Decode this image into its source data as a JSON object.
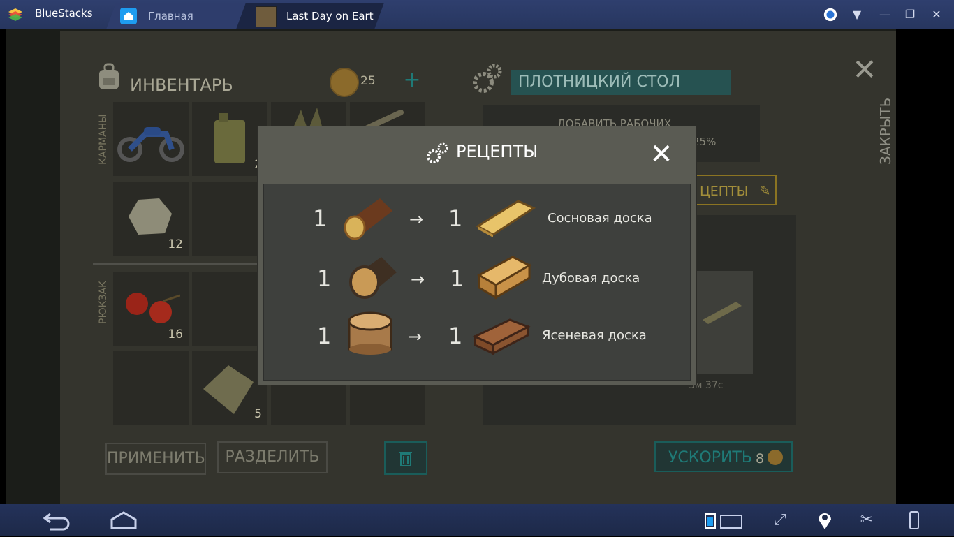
{
  "window": {
    "app_name": "BlueStacks",
    "tabs": [
      {
        "label": "Главная",
        "icon": "home-icon"
      },
      {
        "label": "Last Day on Eart",
        "icon": "game-icon"
      }
    ],
    "controls": [
      "account-icon",
      "menu-dropdown-icon",
      "minimize-icon",
      "restore-icon",
      "close-icon"
    ]
  },
  "inventory": {
    "title": "ИНВЕНТАРЬ",
    "coins": "25",
    "pockets_label": "КАРМАНЫ",
    "backpack_label": "РЮКЗАК",
    "slots": [
      {
        "item": "motorcycle",
        "count": ""
      },
      {
        "item": "jerrycan",
        "count": "2"
      },
      {
        "item": "plant",
        "count": ""
      },
      {
        "item": "branch",
        "count": ""
      },
      {
        "item": "stone",
        "count": "12"
      },
      {
        "item": "berries",
        "count": "16"
      },
      {
        "item": "cloth",
        "count": "5"
      }
    ],
    "apply_button": "ПРИМЕНИТЬ",
    "split_button": "РАЗДЕЛИТЬ"
  },
  "workbench": {
    "title": "ПЛОТНИЦКИЙ СТОЛ",
    "add_workers_label": "ДОБАВИТЬ РАБОЧИХ",
    "workers_percent": "25%",
    "recipes_button": "ЦЕПТЫ",
    "craft_time": "3м 37с",
    "speedup_button": "УСКОРИТЬ",
    "speedup_cost": "8"
  },
  "close_panel": {
    "label": "ЗАКРЫТЬ"
  },
  "modal": {
    "title": "РЕЦЕПТЫ",
    "recipes": [
      {
        "in_qty": "1",
        "in_icon": "pine-log-icon",
        "out_qty": "1",
        "out_icon": "pine-plank-icon",
        "name": "Сосновая доска"
      },
      {
        "in_qty": "1",
        "in_icon": "oak-log-icon",
        "out_qty": "1",
        "out_icon": "oak-plank-icon",
        "name": "Дубовая доска"
      },
      {
        "in_qty": "1",
        "in_icon": "ash-log-icon",
        "out_qty": "1",
        "out_icon": "ash-plank-icon",
        "name": "Ясеневая доска"
      }
    ],
    "arrow": "→"
  },
  "bottom_bar": [
    "back-icon",
    "home-icon",
    "keyboard-toggle-icon",
    "fullscreen-icon",
    "location-icon",
    "scissors-icon",
    "rotate-device-icon"
  ]
}
